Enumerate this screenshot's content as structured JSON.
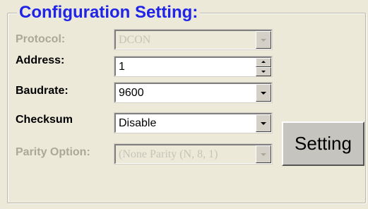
{
  "group": {
    "title": "Configuration Setting:"
  },
  "fields": {
    "protocol": {
      "label": "Protocol:",
      "value": "DCON",
      "enabled": false,
      "icon": "chevron-down-icon"
    },
    "address": {
      "label": "Address:",
      "value": "1",
      "enabled": true,
      "icon": "spin-arrows-icon"
    },
    "baudrate": {
      "label": "Baudrate:",
      "value": "9600",
      "enabled": true,
      "icon": "chevron-down-icon"
    },
    "checksum": {
      "label": "Checksum",
      "value": "Disable",
      "enabled": true,
      "icon": "chevron-down-icon"
    },
    "parity": {
      "label": "Parity Option:",
      "value": "(None Parity (N, 8, 1)",
      "enabled": false,
      "icon": "chevron-down-icon"
    }
  },
  "actions": {
    "setting_label": "Setting"
  },
  "colors": {
    "title": "#1f24e6",
    "panel_bg": "#ece9d8",
    "disabled_text": "#aca899",
    "button_bg": "#c5c4be"
  }
}
